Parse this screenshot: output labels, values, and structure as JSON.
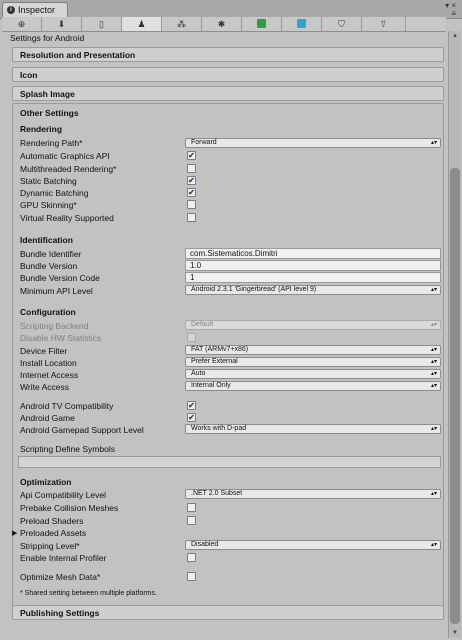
{
  "window": {
    "tab_label": "Inspector",
    "controls": "▾ ×\n≡"
  },
  "platforms": [
    {
      "icon": "web-globe-icon",
      "glyph": "🌐"
    },
    {
      "icon": "download-icon",
      "glyph": "⬇"
    },
    {
      "icon": "mobile-device-icon",
      "glyph": "▯"
    },
    {
      "icon": "android-icon",
      "glyph": "🤖",
      "active": true
    },
    {
      "icon": "blackberry-icon",
      "glyph": "⁂"
    },
    {
      "icon": "puzzle-icon",
      "glyph": "✱"
    },
    {
      "icon": "xbox-green-icon",
      "color": "#2f9e44"
    },
    {
      "icon": "windows-store-icon",
      "color": "#2aa6d6"
    },
    {
      "icon": "html5-icon",
      "glyph": "⛉"
    },
    {
      "icon": "tizen-icon",
      "glyph": "⍢"
    }
  ],
  "title": "Settings for Android",
  "sections": {
    "resolution": "Resolution and Presentation",
    "icon": "Icon",
    "splash": "Splash Image",
    "other": "Other Settings",
    "publishing": "Publishing Settings"
  },
  "rendering": {
    "header": "Rendering",
    "rendering_path": {
      "label": "Rendering Path*",
      "value": "Forward"
    },
    "auto_graphics": {
      "label": "Automatic Graphics API",
      "checked": true
    },
    "multithreaded": {
      "label": "Multithreaded Rendering*",
      "checked": false
    },
    "static_batching": {
      "label": "Static Batching",
      "checked": true
    },
    "dynamic_batching": {
      "label": "Dynamic Batching",
      "checked": true
    },
    "gpu_skinning": {
      "label": "GPU Skinning*",
      "checked": false
    },
    "vr_supported": {
      "label": "Virtual Reality Supported",
      "checked": false
    }
  },
  "identification": {
    "header": "Identification",
    "bundle_identifier": {
      "label": "Bundle Identifier",
      "value": "com.Sistematicos.Dimitri"
    },
    "bundle_version": {
      "label": "Bundle Version",
      "value": "1.0"
    },
    "bundle_version_code": {
      "label": "Bundle Version Code",
      "value": "1"
    },
    "min_api": {
      "label": "Minimum API Level",
      "value": "Android 2.3.1 'Gingerbread' (API level 9)"
    }
  },
  "configuration": {
    "header": "Configuration",
    "scripting_backend": {
      "label": "Scripting Backend",
      "value": "Default"
    },
    "disable_hw_stats": {
      "label": "Disable HW Statistics",
      "checked": false
    },
    "device_filter": {
      "label": "Device Filter",
      "value": "FAT (ARMv7+x86)"
    },
    "install_location": {
      "label": "Install Location",
      "value": "Prefer External"
    },
    "internet_access": {
      "label": "Internet Access",
      "value": "Auto"
    },
    "write_access": {
      "label": "Write Access",
      "value": "Internal Only"
    },
    "android_tv": {
      "label": "Android TV Compatibility",
      "checked": true
    },
    "android_game": {
      "label": "Android Game",
      "checked": true
    },
    "gamepad_support": {
      "label": "Android Gamepad Support Level",
      "value": "Works with D-pad"
    },
    "define_symbols": {
      "label": "Scripting Define Symbols",
      "value": ""
    }
  },
  "optimization": {
    "header": "Optimization",
    "api_compat": {
      "label": "Api Compatibility Level",
      "value": ".NET 2.0 Subset"
    },
    "prebake_collision": {
      "label": "Prebake Collision Meshes",
      "checked": false
    },
    "preload_shaders": {
      "label": "Preload Shaders",
      "checked": false
    },
    "preloaded_assets": {
      "label": "Preloaded Assets"
    },
    "stripping_level": {
      "label": "Stripping Level*",
      "value": "Disabled"
    },
    "internal_profiler": {
      "label": "Enable Internal Profiler",
      "checked": false
    },
    "optimize_mesh": {
      "label": "Optimize Mesh Data*",
      "checked": false
    }
  },
  "footnote": "* Shared setting between multiple platforms.",
  "glyphs": {
    "check": "✔",
    "arrows": "▴▾",
    "foldout": "▶",
    "scroll_up": "▲",
    "scroll_down": "▼"
  }
}
